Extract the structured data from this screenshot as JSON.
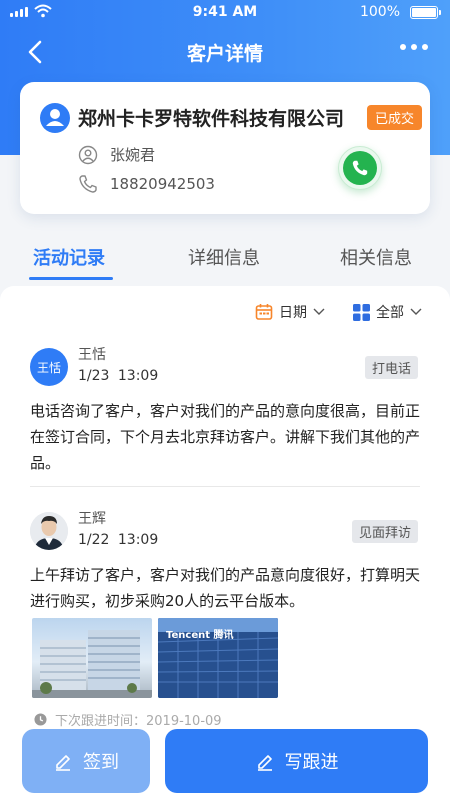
{
  "status_bar": {
    "time": "9:41 AM",
    "battery": "100%"
  },
  "nav": {
    "title": "客户详情"
  },
  "customer": {
    "company": "郑州卡卡罗特软件科技有限公司",
    "status": "已成交",
    "contact": "张婉君",
    "phone": "18820942503"
  },
  "tabs": [
    {
      "label": "活动记录",
      "active": true
    },
    {
      "label": "详细信息",
      "active": false
    },
    {
      "label": "相关信息",
      "active": false
    }
  ],
  "filters": {
    "date_label": "日期",
    "type_label": "全部"
  },
  "activities": [
    {
      "avatar_text": "王恬",
      "name": "王恬",
      "date": "1/23   13:09",
      "type": "打电话",
      "content": "电话咨询了客户，客户对我们的产品的意向度很高，目前正在签订合同，下个月去北京拜访客户。讲解下我们其他的产品。"
    },
    {
      "avatar_text": "",
      "name": "王辉",
      "date": "1/22   13:09",
      "type": "见面拜访",
      "content": "上午拜访了客户，客户对我们的产品意向度很好，打算明天进行购买，初步采购20人的云平台版本。",
      "next_follow": "下次跟进时间：2019-10-09"
    }
  ],
  "photo2_sign": "Tencent 腾讯",
  "buttons": {
    "checkin": "签到",
    "follow": "写跟进"
  },
  "colors": {
    "primary": "#2f7cf6",
    "status_tag": "#f7862b",
    "call_green": "#24b34f"
  }
}
